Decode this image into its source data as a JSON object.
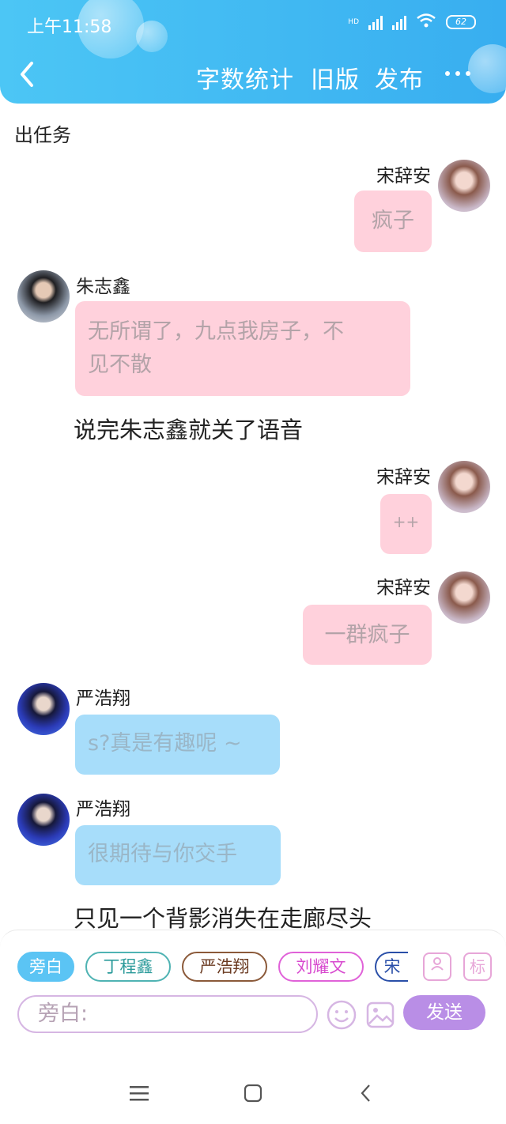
{
  "status_bar": {
    "time": "上午11:58",
    "battery": "62",
    "hd": "HD"
  },
  "header": {
    "word_count_label": "字数统计",
    "old_version_label": "旧版",
    "publish_label": "发布"
  },
  "chat": {
    "top_text": "出任务",
    "messages": [
      {
        "name": "宋辞安",
        "text": "疯子"
      },
      {
        "name": "朱志鑫",
        "text_line1": "无所谓了，九点我房子，不",
        "text_line2": "见不散"
      },
      {
        "narration": "说完朱志鑫就关了语音"
      },
      {
        "name": "宋辞安",
        "text": "++"
      },
      {
        "name": "宋辞安",
        "text": "一群疯子"
      },
      {
        "name": "严浩翔",
        "text": "s?真是有趣呢 ~"
      },
      {
        "name": "严浩翔",
        "text": "很期待与你交手"
      },
      {
        "narration": "只见一个背影消失在走廊尽头"
      }
    ]
  },
  "input_panel": {
    "chips": [
      "旁白",
      "丁程鑫",
      "严浩翔",
      "刘耀文",
      "宋"
    ],
    "mark_label": "标",
    "input_placeholder": "旁白:",
    "send_label": "发送"
  },
  "colors": {
    "header_start": "#4cc6f5",
    "header_end": "#38aef0",
    "pink_bubble": "#ffd1dc",
    "blue_bubble": "#a7ddfa",
    "send_button": "#b98ee6"
  }
}
